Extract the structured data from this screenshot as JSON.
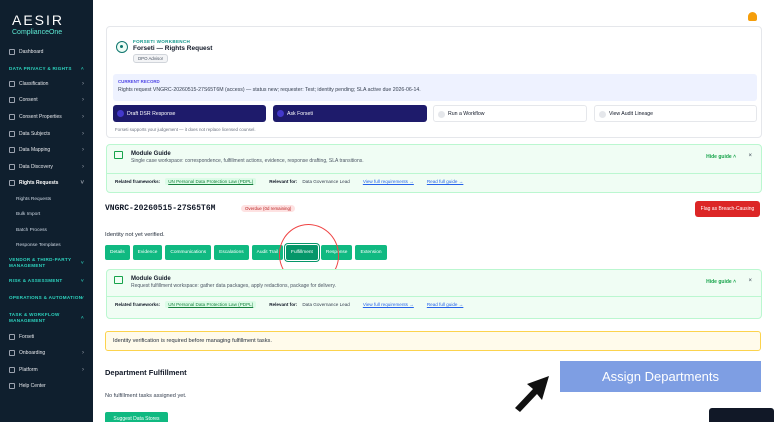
{
  "brand": {
    "name": "AESIR",
    "sub": "ComplianceOne"
  },
  "sidebar": {
    "dashboard": "Dashboard",
    "section_privacy": "DATA PRIVACY & RIGHTS",
    "items": [
      "Classification",
      "Consent",
      "Consent Properties",
      "Data Subjects",
      "Data Mapping",
      "Data Discovery"
    ],
    "rights_requests": "Rights Requests",
    "sub_items": [
      "Rights Requests",
      "Bulk Import",
      "Batch Process",
      "Response Templates"
    ],
    "section_vendor": "VENDOR & THIRD-PARTY MANAGEMENT",
    "section_risk": "RISK & ASSESSMENT",
    "section_ops": "OPERATIONS & AUTOMATION",
    "section_task": "TASK & WORKFLOW MANAGEMENT",
    "bottom_items": [
      "Forseti",
      "Onboarding",
      "Platform",
      "Help Center"
    ]
  },
  "header": {
    "workbench_label": "FORSETI WORKBENCH",
    "title": "Forseti — Rights Request",
    "badge": "DPO Advisor",
    "record_label": "CURRENT RECORD",
    "record_text": "Rights request VNGRC-20260515-27S65T6M (access) — status new; requester: Test; identity pending; SLA active due 2026-06-14.",
    "actions": [
      "Draft DSR Response",
      "Ask Forseti",
      "Run a Workflow",
      "View Audit Lineage"
    ],
    "support_note": "Forseti supports your judgement — it does not replace licensed counsel."
  },
  "guide1": {
    "title": "Module Guide",
    "desc": "Single case workspace: correspondence, fulfillment actions, evidence, response drafting, SLA transitions.",
    "hide": "Hide guide ˄",
    "close": "×",
    "frameworks_label": "Related frameworks:",
    "framework": "UN Personal Data Protection Law (PDPL)",
    "relevant_label": "Relevant for:",
    "relevant": "Data Governance Lead",
    "view_req": "View full requirements →",
    "read_guide": "Read full guide →"
  },
  "case": {
    "id": "VNGRC-20260515-27S65T6M",
    "overdue": "Overdue (0d remaining)",
    "flag_button": "Flag as Breach-Causing",
    "identity_note": "Identity not yet verified."
  },
  "tabs": [
    "Details",
    "Evidence",
    "Communications",
    "Escalations",
    "Audit Trail",
    "Fulfillment",
    "Response",
    "Extension"
  ],
  "guide2": {
    "title": "Module Guide",
    "desc": "Request fulfillment workspace: gather data packages, apply redactions, package for delivery.",
    "hide": "Hide guide ˄",
    "close": "×",
    "frameworks_label": "Related frameworks:",
    "framework": "UN Personal Data Protection Law (PDPL)",
    "relevant_label": "Relevant for:",
    "relevant": "Data Governance Lead",
    "view_req": "View full requirements →",
    "read_guide": "Read full guide →"
  },
  "warning": "Identity verification is required before managing fulfillment tasks.",
  "fulfillment": {
    "title": "Department Fulfillment",
    "empty": "No fulfillment tasks assigned yet.",
    "suggest_button": "Suggest Data Stores"
  },
  "overlay": {
    "assign": "Assign Departments"
  },
  "colors": {
    "accent": "#10b981",
    "sidebar": "#0f1f2e",
    "danger": "#dc2626",
    "overlay": "#7e9ee3"
  }
}
